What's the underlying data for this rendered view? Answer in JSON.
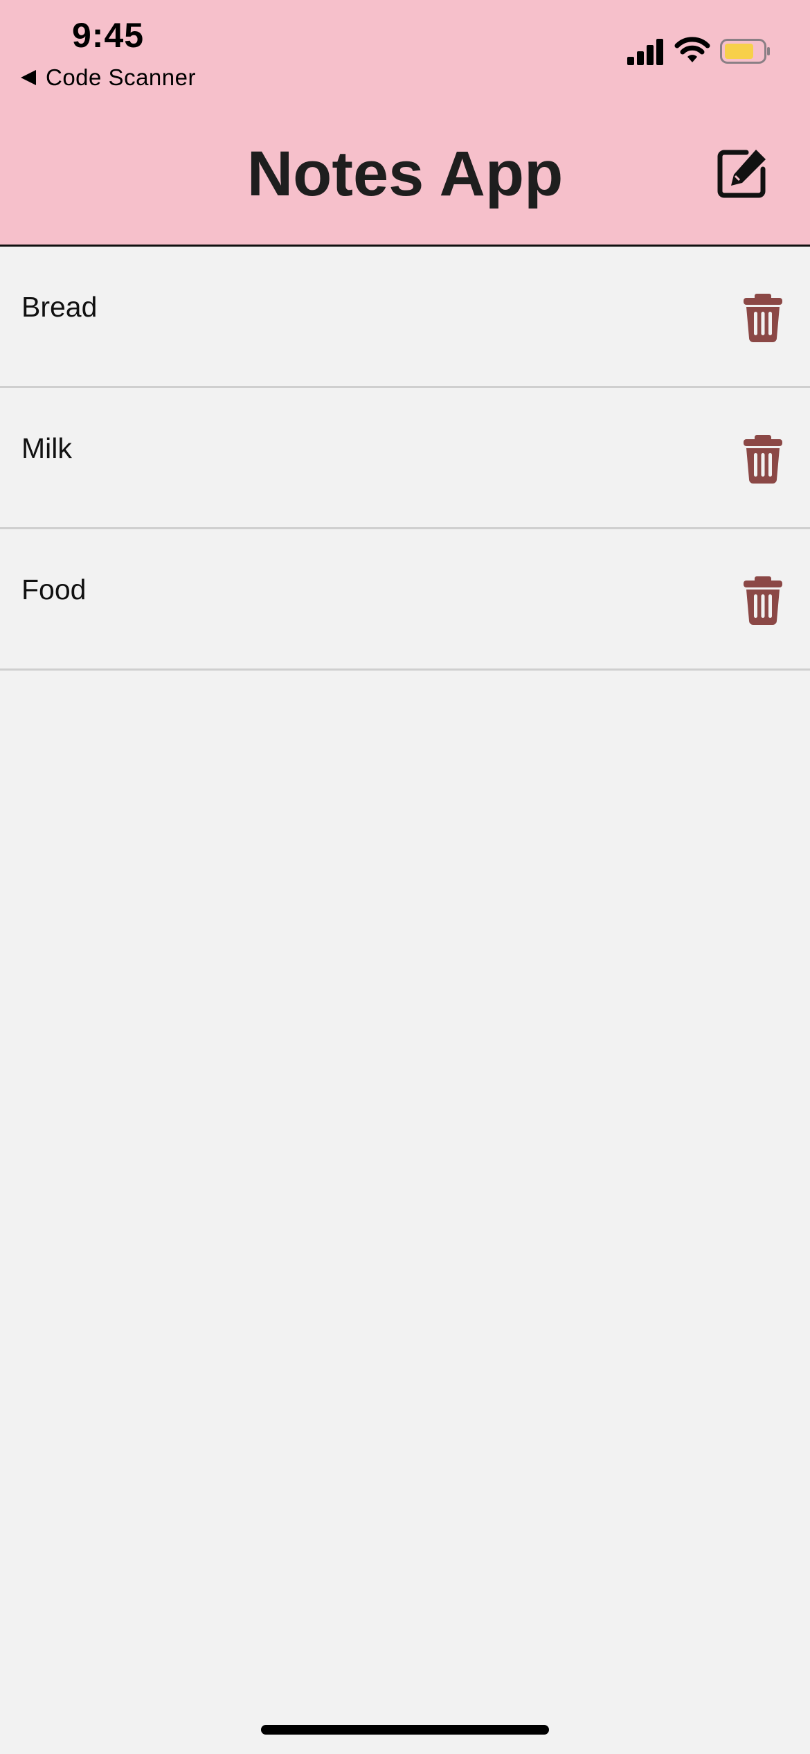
{
  "status_bar": {
    "time": "9:45",
    "back_label": "Code Scanner",
    "battery_color": "#f7d04a"
  },
  "header": {
    "title": "Notes App",
    "background": "#f6c0cb",
    "compose_icon": "compose-icon"
  },
  "notes": [
    {
      "text": "Bread",
      "action_icon": "trash-icon"
    },
    {
      "text": "Milk",
      "action_icon": "trash-icon"
    },
    {
      "text": "Food",
      "action_icon": "trash-icon"
    }
  ],
  "colors": {
    "trash": "#8b4846",
    "list_background": "#f2f2f2",
    "divider": "#cfcfcf"
  }
}
